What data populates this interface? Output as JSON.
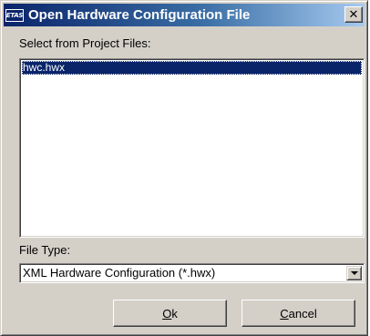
{
  "window": {
    "icon_text": "ETAS",
    "title": "Open Hardware Configuration File",
    "close_glyph": "✕"
  },
  "project_files": {
    "label": "Select from Project Files:",
    "items": [
      {
        "label": "hwc.hwx",
        "selected": true
      }
    ]
  },
  "file_type": {
    "label": "File Type:",
    "selected": "XML Hardware Configuration (*.hwx)"
  },
  "buttons": {
    "ok": {
      "mnemonic": "O",
      "rest": "k"
    },
    "cancel": {
      "mnemonic": "C",
      "rest": "ancel"
    }
  }
}
